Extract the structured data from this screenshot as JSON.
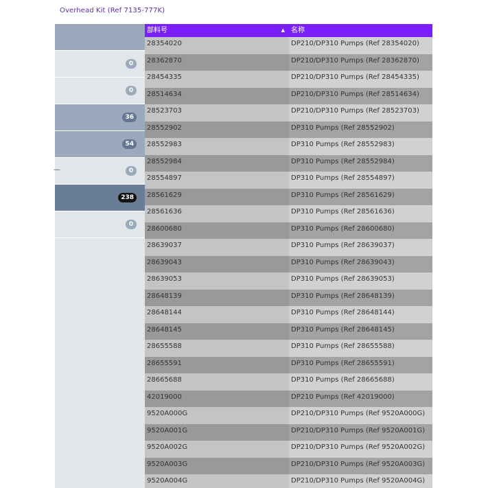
{
  "breadcrumb": "Overhead Kit (Ref 7135-777K)",
  "sidebar": {
    "items": [
      {
        "label": "",
        "badge": "",
        "shade": "mid",
        "badge_style": ""
      },
      {
        "label": "",
        "badge": "0",
        "shade": "light",
        "badge_style": "light"
      },
      {
        "label": "",
        "badge": "0",
        "shade": "light",
        "badge_style": "light"
      },
      {
        "label": "",
        "badge": "36",
        "shade": "mid",
        "badge_style": "mid"
      },
      {
        "label": "",
        "badge": "54",
        "shade": "mid",
        "badge_style": "mid"
      },
      {
        "label": "—",
        "badge": "0",
        "shade": "light",
        "badge_style": "light"
      },
      {
        "label": "",
        "badge": "238",
        "shade": "dark",
        "badge_style": "dark"
      },
      {
        "label": "",
        "badge": "0",
        "shade": "light",
        "badge_style": "light"
      }
    ]
  },
  "grid": {
    "headers": {
      "part": "部料号",
      "name": "名称"
    },
    "rows": [
      {
        "part": "28354020",
        "name": "DP210/DP310 Pumps (Ref 28354020)"
      },
      {
        "part": "28362870",
        "name": "DP210/DP310 Pumps (Ref 28362870)"
      },
      {
        "part": "28454335",
        "name": "DP210/DP310 Pumps (Ref 28454335)"
      },
      {
        "part": "28514634",
        "name": "DP210/DP310 Pumps (Ref 28514634)"
      },
      {
        "part": "28523703",
        "name": "DP210/DP310 Pumps (Ref 28523703)"
      },
      {
        "part": "28552902",
        "name": "DP310 Pumps (Ref 28552902)"
      },
      {
        "part": "28552983",
        "name": "DP310 Pumps (Ref 28552983)"
      },
      {
        "part": "28552984",
        "name": "DP310 Pumps (Ref 28552984)"
      },
      {
        "part": "28554897",
        "name": "DP310 Pumps (Ref 28554897)"
      },
      {
        "part": "28561629",
        "name": "DP310 Pumps (Ref 28561629)"
      },
      {
        "part": "28561636",
        "name": "DP310 Pumps (Ref 28561636)"
      },
      {
        "part": "28600680",
        "name": "DP310 Pumps (Ref 28600680)"
      },
      {
        "part": "28639037",
        "name": "DP310 Pumps (Ref 28639037)"
      },
      {
        "part": "28639043",
        "name": "DP310 Pumps (Ref 28639043)"
      },
      {
        "part": "28639053",
        "name": "DP310 Pumps (Ref 28639053)"
      },
      {
        "part": "28648139",
        "name": "DP310 Pumps (Ref 28648139)"
      },
      {
        "part": "28648144",
        "name": "DP310 Pumps (Ref 28648144)"
      },
      {
        "part": "28648145",
        "name": "DP310 Pumps (Ref 28648145)"
      },
      {
        "part": "28655588",
        "name": "DP310 Pumps (Ref 28655588)"
      },
      {
        "part": "28655591",
        "name": "DP310 Pumps (Ref 28655591)"
      },
      {
        "part": "28665688",
        "name": "DP310 Pumps (Ref 28665688)"
      },
      {
        "part": "42019000",
        "name": "DP210 Pumps (Ref 42019000)"
      },
      {
        "part": "9520A000G",
        "name": "DP210/DP310 Pumps (Ref 9520A000G)"
      },
      {
        "part": "9520A001G",
        "name": "DP210/DP310 Pumps (Ref 9520A001G)"
      },
      {
        "part": "9520A002G",
        "name": "DP210/DP310 Pumps (Ref 9520A002G)"
      },
      {
        "part": "9520A003G",
        "name": "DP210/DP310 Pumps (Ref 9520A003G)"
      },
      {
        "part": "9520A004G",
        "name": "DP210/DP310 Pumps (Ref 9520A004G)"
      }
    ]
  }
}
